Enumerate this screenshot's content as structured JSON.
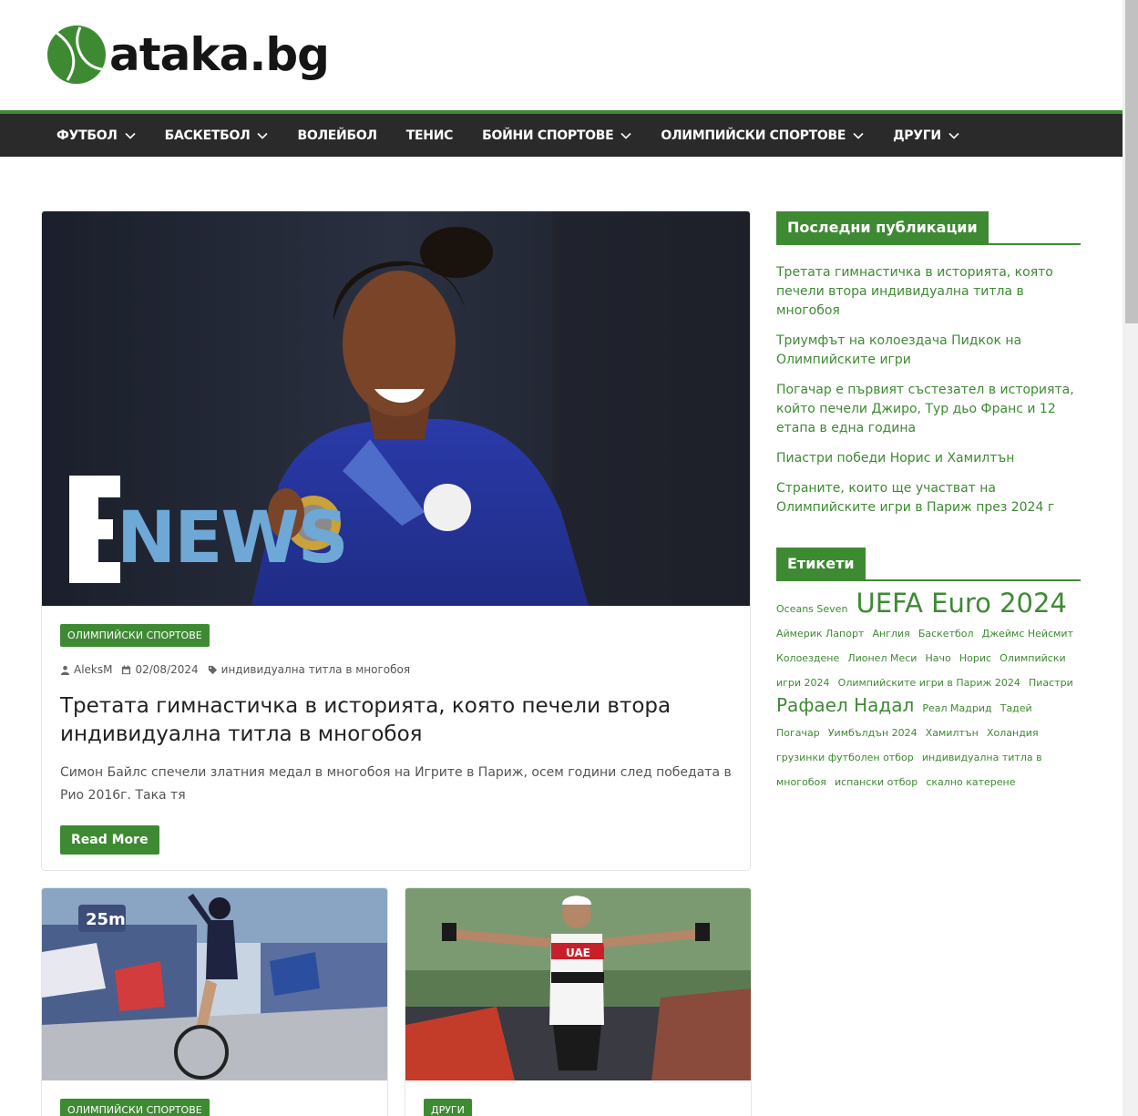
{
  "site": {
    "logo_text": "ataka.bg"
  },
  "nav": [
    {
      "label": "ФУТБОЛ",
      "has_dropdown": true
    },
    {
      "label": "БАСКЕТБОЛ",
      "has_dropdown": true
    },
    {
      "label": "ВОЛЕЙБОЛ",
      "has_dropdown": false
    },
    {
      "label": "ТЕНИС",
      "has_dropdown": false
    },
    {
      "label": "БОЙНИ СПОРТОВЕ",
      "has_dropdown": true
    },
    {
      "label": "ОЛИМПИЙСКИ СПОРТОВЕ",
      "has_dropdown": true
    },
    {
      "label": "ДРУГИ",
      "has_dropdown": true
    }
  ],
  "featured": {
    "image_text": "E NEWS",
    "category": "ОЛИМПИЙСКИ СПОРТОВЕ",
    "author": "AleksM",
    "date": "02/08/2024",
    "tag": "индивидуална титла в многобоя",
    "title": "Третата гимнастичка в историята, която печели втора индивидуална титла в многобоя",
    "excerpt": "Симон Байлс спечели златния медал в многобоя на Игрите в Париж, осем години след победата в Рио 2016г. Така тя",
    "read_more": "Read More"
  },
  "cards": [
    {
      "category": "ОЛИМПИЙСКИ СПОРТОВЕ",
      "image_text": "25m"
    },
    {
      "category": "ДРУГИ",
      "image_text": "UAE Emirates EMAAR"
    }
  ],
  "sidebar": {
    "recent_title": "Последни публикации",
    "recent_posts": [
      "Третата гимнастичка в историята, която печели втора индивидуална титла в многобоя",
      "Триумфът на колоездача Пидкок на Олимпийските игри",
      "Погачар е първият състезател в историята, който печели Джиро, Тур дьо Франс и 12 етапа в една година",
      "Пиастри победи Норис и Хамилтън",
      "Страните, които ще участват на Олимпийските игри в Париж през 2024 г"
    ],
    "tags_title": "Етикети",
    "tags": [
      {
        "text": "Oceans Seven",
        "size": "s"
      },
      {
        "text": "UEFA Euro 2024",
        "size": "xl"
      },
      {
        "text": "Аймерик Лапорт",
        "size": "s"
      },
      {
        "text": "Англия",
        "size": "s"
      },
      {
        "text": "Баскетбол",
        "size": "s"
      },
      {
        "text": "Джеймс Нейсмит",
        "size": "s"
      },
      {
        "text": "Колоездене",
        "size": "s"
      },
      {
        "text": "Лионел Меси",
        "size": "s"
      },
      {
        "text": "Начо",
        "size": "s"
      },
      {
        "text": "Норис",
        "size": "s"
      },
      {
        "text": "Олимпийски игри 2024",
        "size": "s"
      },
      {
        "text": "Олимпийските игри в Париж 2024",
        "size": "s"
      },
      {
        "text": "Пиастри",
        "size": "s"
      },
      {
        "text": "Рафаел Надал",
        "size": "l"
      },
      {
        "text": "Реал Мадрид",
        "size": "s"
      },
      {
        "text": "Тадей Погачар",
        "size": "s"
      },
      {
        "text": "Уимбълдън 2024",
        "size": "s"
      },
      {
        "text": "Хамилтън",
        "size": "s"
      },
      {
        "text": "Холандия",
        "size": "s"
      },
      {
        "text": "грузинки футболен отбор",
        "size": "s"
      },
      {
        "text": "индивидуална титла в многобоя",
        "size": "s"
      },
      {
        "text": "испански отбор",
        "size": "s"
      },
      {
        "text": "скално катерене",
        "size": "s"
      }
    ]
  },
  "colors": {
    "accent": "#3e8a33",
    "nav_bg": "#2a2a2a"
  }
}
